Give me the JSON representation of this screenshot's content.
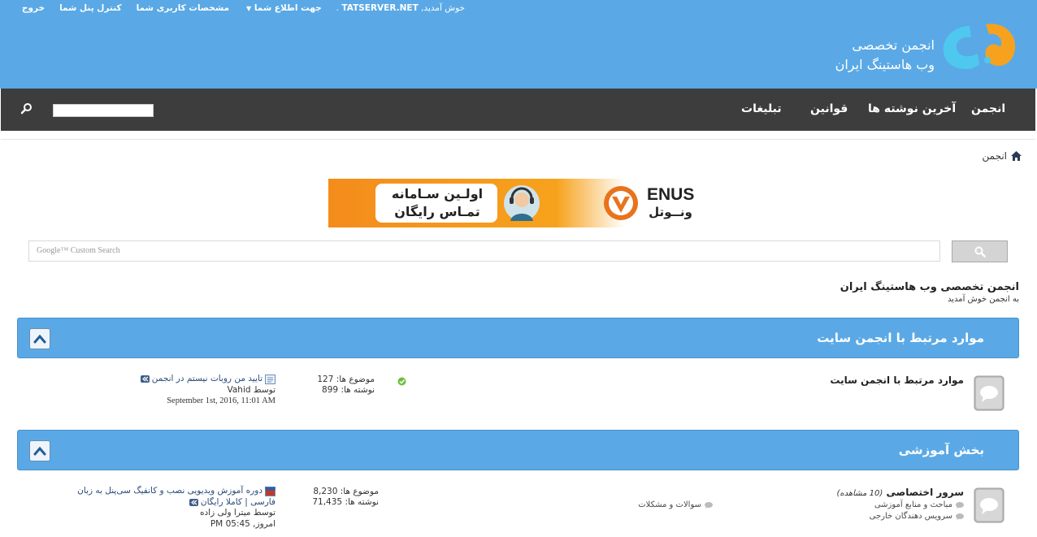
{
  "header": {
    "toplinks": {
      "logout": "خروج",
      "control_panel": "کنترل پنل شما",
      "profile": "مشخصات کاربری شما",
      "notifications": "جهت اطلاع شما",
      "welcome": "خوش آمدید,",
      "username": "TATSERVER.NET",
      "dot": "."
    },
    "logo_line1": "انجمن تخصصی",
    "logo_line2": "وب هاستینگ ایران"
  },
  "nav": {
    "items": [
      "انجمن",
      "آخرین نوشته ها",
      "قوانین",
      "تبلیغات"
    ]
  },
  "breadcrumb": {
    "home": "انجمن"
  },
  "banner": {
    "line1": "اولـین سـامانه",
    "line2": "تمـاس رایگان",
    "brand_en": "ENUS",
    "brand_fa": "ونــوتل"
  },
  "google_search": {
    "placeholder_brand": "Google™",
    "placeholder_text": "Custom Search"
  },
  "forum_intro": {
    "title": "انجمن تخصصی وب هاستینگ ایران",
    "subtitle": "به انجمن خوش آمدید"
  },
  "categories": [
    {
      "title": "موارد مرتبط با انجمن سایت",
      "forums": [
        {
          "name": "موارد مرتبط با انجمن سایت",
          "viewers": "",
          "subforums": [],
          "topics_label": "موضوع ها:",
          "topics": "127",
          "posts_label": "نوشته ها:",
          "posts": "899",
          "last_post": {
            "title": "تایید من روبات نیستم در انجمن",
            "by_label": "توسط",
            "author": "Vahid",
            "time": "September 1st, 2016, 11:01 AM"
          }
        }
      ]
    },
    {
      "title": "بخش آموزشی",
      "forums": [
        {
          "name": "سرور اختصاصی",
          "viewers": "(10 مشاهده)",
          "subforums": [
            "مباحث و منابع آموزشی",
            "سرویس دهندگان خارجی",
            "سوالات و مشکلات"
          ],
          "topics_label": "موضوع ها:",
          "topics": "8,230",
          "posts_label": "نوشته ها:",
          "posts": "71,435",
          "last_post": {
            "title_line1": "دوره آموزش ویدیویی نصب و کانفیگ سی‌پنل به زبان",
            "title_line2": "فارسی | کاملا رایگان",
            "by_label": "توسط",
            "author": "میترا ولی زاده",
            "time": "امروز, 05:45 PM"
          }
        }
      ]
    }
  ],
  "colors": {
    "header_blue": "#5aa9e6",
    "nav_dark": "#3d3d3d",
    "banner_orange": "#f48c1b"
  }
}
